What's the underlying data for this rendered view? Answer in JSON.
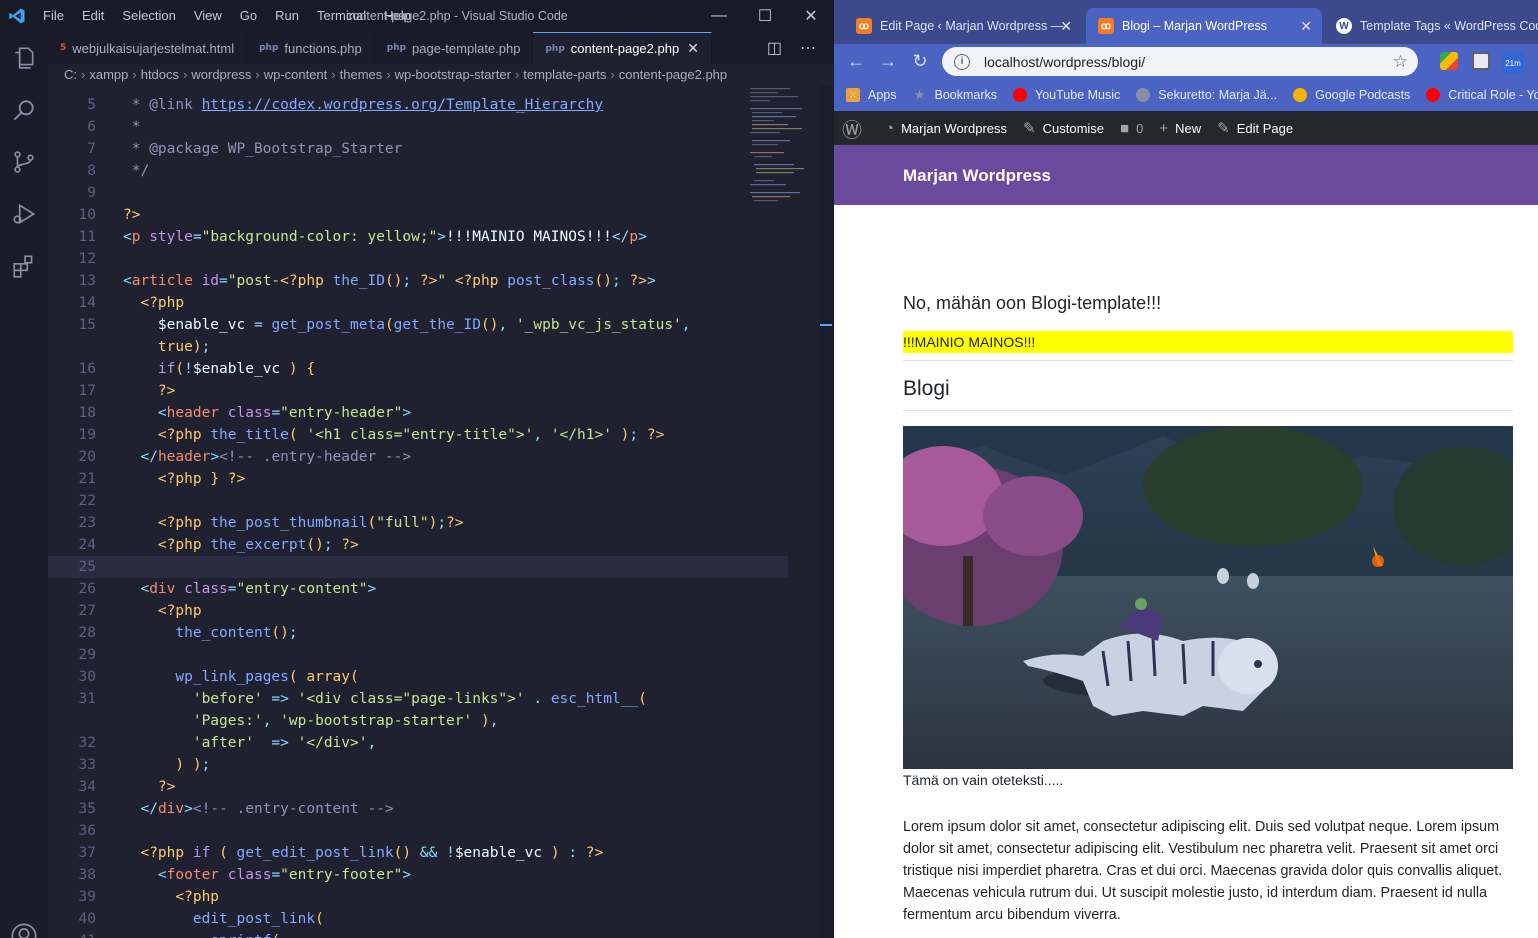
{
  "vscode": {
    "window_title": "content-page2.php - Visual Studio Code",
    "menu": [
      "File",
      "Edit",
      "Selection",
      "View",
      "Go",
      "Run",
      "Terminal",
      "Help"
    ],
    "tabs": [
      {
        "label": "webjulkaisujarjestelmat.html",
        "icon": "html5-icon",
        "icon_text": "5",
        "icon_color": "#e44d26",
        "active": false
      },
      {
        "label": "functions.php",
        "icon": "php-icon",
        "icon_text": "php",
        "icon_color": "#7a86b8",
        "active": false
      },
      {
        "label": "page-template.php",
        "icon": "php-icon",
        "icon_text": "php",
        "icon_color": "#7a86b8",
        "active": false
      },
      {
        "label": "content-page2.php",
        "icon": "php-icon",
        "icon_text": "php",
        "icon_color": "#7a86b8",
        "active": true
      }
    ],
    "breadcrumb": [
      "C:",
      "xampp",
      "htdocs",
      "wordpress",
      "wp-content",
      "themes",
      "wp-bootstrap-starter",
      "template-parts",
      "content-page2.php"
    ],
    "code_lines": [
      {
        "n": "5",
        "html": "<span class='t-com'> * @link </span><span class='t-url'>https://codex.wordpress.org/Template_Hierarchy</span>"
      },
      {
        "n": "6",
        "html": "<span class='t-com'> *</span>"
      },
      {
        "n": "7",
        "html": "<span class='t-com'> * @package WP_Bootstrap_Starter</span>"
      },
      {
        "n": "8",
        "html": "<span class='t-com'> */</span>"
      },
      {
        "n": "9",
        "html": ""
      },
      {
        "n": "10",
        "html": "<span class='t-php'>?></span>"
      },
      {
        "n": "11",
        "html": "<span class='t-punc'>&lt;</span><span class='t-tag'>p</span> <span class='t-attr'>style</span><span class='t-punc'>=</span><span class='t-str'>\"background-color: yellow;\"</span><span class='t-punc'>&gt;</span><span class='t-txt'>!!!MAINIO MAINOS!!!</span><span class='t-punc'>&lt;/</span><span class='t-tag'>p</span><span class='t-punc'>&gt;</span>"
      },
      {
        "n": "12",
        "html": ""
      },
      {
        "n": "13",
        "html": "<span class='t-punc'>&lt;</span><span class='t-tag'>article</span> <span class='t-attr'>id</span><span class='t-punc'>=</span><span class='t-str'>\"post-</span><span class='t-php'>&lt;?php</span> <span class='t-fn'>the_ID</span><span class='t-php'>()</span><span class='t-punc'>;</span> <span class='t-php'>?></span><span class='t-str'>\"</span> <span class='t-php'>&lt;?php</span> <span class='t-fn'>post_class</span><span class='t-php'>()</span><span class='t-punc'>;</span> <span class='t-php'>?></span><span class='t-punc'>&gt;</span>"
      },
      {
        "n": "14",
        "html": "  <span class='t-php'>&lt;?php</span>"
      },
      {
        "n": "15",
        "html": "    <span class='t-var'>$enable_vc</span> <span class='t-punc'>=</span> <span class='t-fn'>get_post_meta</span><span class='t-php'>(</span><span class='t-fn'>get_the_ID</span><span class='t-php'>()</span><span class='t-punc'>,</span> <span class='t-str'>'_wpb_vc_js_status'</span><span class='t-punc'>,</span>"
      },
      {
        "n": "",
        "html": "    <span class='t-php'>true</span><span class='t-php'>)</span><span class='t-punc'>;</span>"
      },
      {
        "n": "16",
        "html": "    <span class='t-kw'>if</span><span class='t-php'>(</span><span class='t-punc'>!</span><span class='t-var'>$enable_vc</span> <span class='t-php'>)</span> <span class='t-php'>{</span>"
      },
      {
        "n": "17",
        "html": "    <span class='t-php'>?></span>"
      },
      {
        "n": "18",
        "html": "    <span class='t-punc'>&lt;</span><span class='t-tag'>header</span> <span class='t-attr'>class</span><span class='t-punc'>=</span><span class='t-str'>\"entry-header\"</span><span class='t-punc'>&gt;</span>"
      },
      {
        "n": "19",
        "html": "    <span class='t-php'>&lt;?php</span> <span class='t-fn'>the_title</span><span class='t-php'>(</span> <span class='t-str'>'&lt;h1 class=\"entry-title\"&gt;'</span><span class='t-punc'>,</span> <span class='t-str'>'&lt;/h1&gt;'</span> <span class='t-php'>)</span><span class='t-punc'>;</span> <span class='t-php'>?></span>"
      },
      {
        "n": "20",
        "html": "  <span class='t-punc'>&lt;/</span><span class='t-tag'>header</span><span class='t-punc'>&gt;</span><span class='t-com'>&lt;!-- .entry-header --&gt;</span>"
      },
      {
        "n": "21",
        "html": "    <span class='t-php'>&lt;?php</span> <span class='t-php'>}</span> <span class='t-php'>?></span>"
      },
      {
        "n": "22",
        "html": ""
      },
      {
        "n": "23",
        "html": "    <span class='t-php'>&lt;?php</span> <span class='t-fn'>the_post_thumbnail</span><span class='t-php'>(</span><span class='t-str'>\"full\"</span><span class='t-php'>)</span><span class='t-punc'>;</span><span class='t-php'>?></span>"
      },
      {
        "n": "24",
        "html": "    <span class='t-php'>&lt;?php</span> <span class='t-fn'>the_excerpt</span><span class='t-php'>()</span><span class='t-punc'>;</span> <span class='t-php'>?></span>"
      },
      {
        "n": "25",
        "html": "",
        "current": true
      },
      {
        "n": "26",
        "html": "  <span class='t-punc'>&lt;</span><span class='t-tag'>div</span> <span class='t-attr'>class</span><span class='t-punc'>=</span><span class='t-str'>\"entry-content\"</span><span class='t-punc'>&gt;</span>"
      },
      {
        "n": "27",
        "html": "    <span class='t-php'>&lt;?php</span>"
      },
      {
        "n": "28",
        "html": "      <span class='t-fn'>the_content</span><span class='t-php'>()</span><span class='t-punc'>;</span>"
      },
      {
        "n": "29",
        "html": ""
      },
      {
        "n": "30",
        "html": "      <span class='t-fn'>wp_link_pages</span><span class='t-php'>(</span> <span class='t-php'>array</span><span class='t-php'>(</span>"
      },
      {
        "n": "31",
        "html": "        <span class='t-str'>'before'</span> <span class='t-punc'>=&gt;</span> <span class='t-str'>'&lt;div class=\"page-links\"&gt;'</span> <span class='t-punc'>.</span> <span class='t-fn'>esc_html__</span><span class='t-php'>(</span>"
      },
      {
        "n": "",
        "html": "        <span class='t-str'>'Pages:'</span><span class='t-punc'>,</span> <span class='t-str'>'wp-bootstrap-starter'</span> <span class='t-php'>)</span><span class='t-punc'>,</span>"
      },
      {
        "n": "32",
        "html": "        <span class='t-str'>'after'</span>  <span class='t-punc'>=&gt;</span> <span class='t-str'>'&lt;/div&gt;'</span><span class='t-punc'>,</span>"
      },
      {
        "n": "33",
        "html": "      <span class='t-php'>)</span> <span class='t-php'>)</span><span class='t-punc'>;</span>"
      },
      {
        "n": "34",
        "html": "    <span class='t-php'>?></span>"
      },
      {
        "n": "35",
        "html": "  <span class='t-punc'>&lt;/</span><span class='t-tag'>div</span><span class='t-punc'>&gt;</span><span class='t-com'>&lt;!-- .entry-content --&gt;</span>"
      },
      {
        "n": "36",
        "html": ""
      },
      {
        "n": "37",
        "html": "  <span class='t-php'>&lt;?php</span> <span class='t-kw'>if</span> <span class='t-php'>(</span> <span class='t-fn'>get_edit_post_link</span><span class='t-php'>()</span> <span class='t-punc'>&amp;&amp;</span> <span class='t-punc'>!</span><span class='t-var'>$enable_vc</span> <span class='t-php'>)</span> <span class='t-punc'>:</span> <span class='t-php'>?></span>"
      },
      {
        "n": "38",
        "html": "    <span class='t-punc'>&lt;</span><span class='t-tag'>footer</span> <span class='t-attr'>class</span><span class='t-punc'>=</span><span class='t-str'>\"entry-footer\"</span><span class='t-punc'>&gt;</span>"
      },
      {
        "n": "39",
        "html": "      <span class='t-php'>&lt;?php</span>"
      },
      {
        "n": "40",
        "html": "        <span class='t-fn'>edit_post_link</span><span class='t-php'>(</span>"
      },
      {
        "n": "41",
        "html": "          <span class='t-fn'>sprintf</span><span class='t-php'>(</span>"
      }
    ]
  },
  "chrome": {
    "tabs": [
      {
        "label": "Edit Page ‹ Marjan Wordpress —",
        "icon": "xampp-icon",
        "active": false
      },
      {
        "label": "Blogi – Marjan WordPress",
        "icon": "xampp-icon",
        "active": true
      },
      {
        "label": "Template Tags « WordPress Codex",
        "icon": "wordpress-icon",
        "active": false
      }
    ],
    "url": "localhost/wordpress/blogi/",
    "bookmarks": [
      {
        "label": "Apps",
        "icon": "apps-icon",
        "color": "#e8a33d"
      },
      {
        "label": "Bookmarks",
        "icon": "star-icon",
        "color": "#8a8fa8"
      },
      {
        "label": "YouTube Music",
        "icon": "youtube-music-icon",
        "color": "#ff0000"
      },
      {
        "label": "Sekuretto: Marja Jä...",
        "icon": "globe-icon",
        "color": "#8a8fa8"
      },
      {
        "label": "Google Podcasts",
        "icon": "podcasts-icon",
        "color": "#f4b400"
      },
      {
        "label": "Critical Role - You...",
        "icon": "youtube-icon",
        "color": "#ff0000"
      }
    ],
    "extension_badge": "21m"
  },
  "wp": {
    "adminbar": [
      {
        "label": "",
        "icon": "wordpress-logo-icon"
      },
      {
        "label": "Marjan Wordpress",
        "icon": "dashboard-icon"
      },
      {
        "label": "Customise",
        "icon": "brush-icon"
      },
      {
        "label": "0",
        "icon": "comment-icon"
      },
      {
        "label": "New",
        "icon": "plus-icon"
      },
      {
        "label": "Edit Page",
        "icon": "pencil-icon"
      }
    ],
    "site_name": "Marjan Wordpress",
    "post_title": "No, mähän oon Blogi-template!!!",
    "ad_text": "!!!MAINIO MAINOS!!!",
    "entry_title": "Blogi",
    "excerpt": "Tämä on vain oteteksti.....",
    "content": "Lorem ipsum dolor sit amet, consectetur adipiscing elit. Duis sed volutpat neque. Lorem ipsum dolor sit amet, consectetur adipiscing elit. Vestibulum nec pharetra velit. Praesent sit amet orci tristique nisi imperdiet pharetra. Cras et dui orci. Maecenas gravida dolor quis convallis aliquet. Maecenas vehicula rutrum dui. Ut suscipit molestie justo, id interdum diam. Praesent id nulla fermentum arcu bibendum viverra.",
    "colors": {
      "header": "#6a4a9c",
      "ad_background": "#ffff00"
    }
  }
}
